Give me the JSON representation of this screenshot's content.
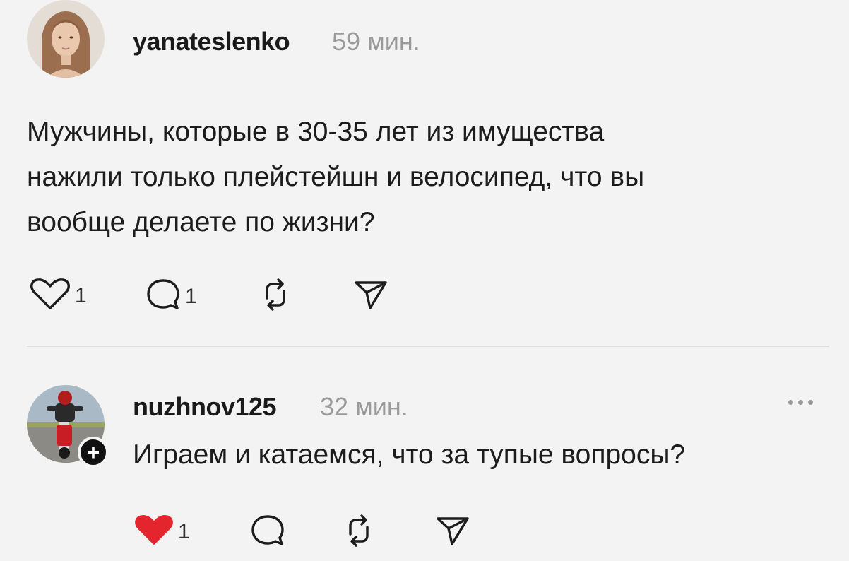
{
  "post": {
    "username": "yanateslenko",
    "time": "59 мин.",
    "text_lines": [
      "Мужчины, которые в 30-35 лет из имущества",
      "нажили только плейстейшн и велосипед, что вы",
      "вообще делаете по жизни?"
    ],
    "likes": "1",
    "replies": "1",
    "liked": false
  },
  "reply": {
    "username": "nuzhnov125",
    "time": "32 мин.",
    "text": "Играем и катаемся, что за тупые вопросы?",
    "likes": "1",
    "liked": true
  },
  "colors": {
    "background": "#f3f3f3",
    "text": "#1c1c1c",
    "muted": "#9a9a9a",
    "like_active": "#e5252e",
    "divider": "#dcdcdc"
  },
  "icons": {
    "like": "heart-icon",
    "reply": "comment-icon",
    "repost": "repost-icon",
    "share": "send-icon",
    "more": "more-dots-icon",
    "follow": "plus-icon"
  }
}
